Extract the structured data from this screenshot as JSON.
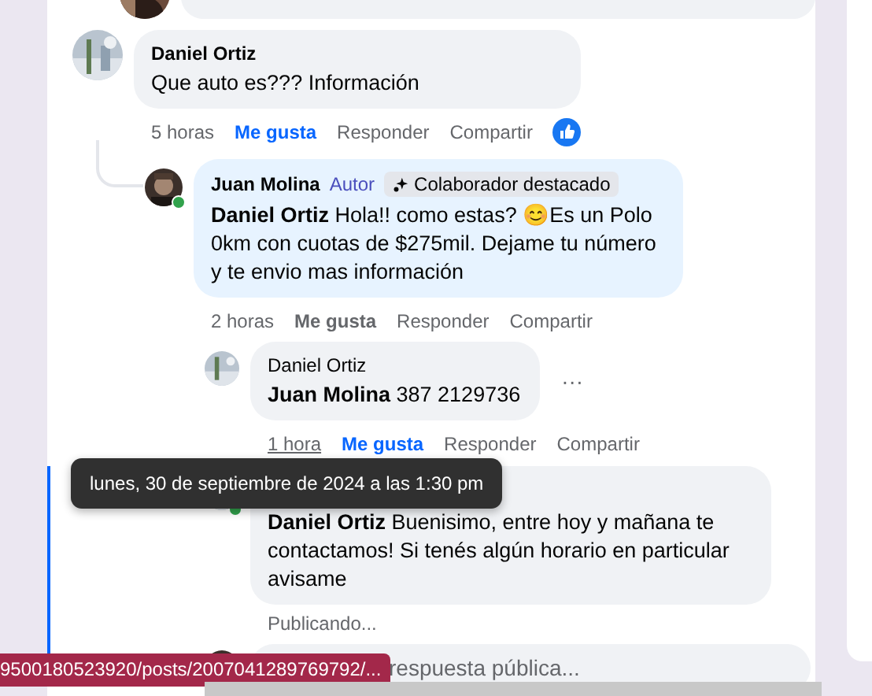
{
  "comments": [
    {
      "author": "Daniel Ortiz",
      "text": "Que auto es??? Información",
      "time": "5 horas",
      "time_hovered": false,
      "like": "Me gusta",
      "liked": true,
      "reply": "Responder",
      "share": "Compartir",
      "reaction": true,
      "replies": [
        {
          "author": "Juan Molina",
          "role": "Autor",
          "badge": "Colaborador destacado",
          "online": true,
          "highlighted": true,
          "text": "**Daniel Ortiz** Hola!! como estas? 😊Es un Polo 0km con cuotas de $275mil. Dejame tu número y te envio mas información",
          "time": "2 horas",
          "time_hovered": false,
          "like": "Me gusta",
          "liked": false,
          "reply": "Responder",
          "share": "Compartir",
          "replies": [
            {
              "author": "Daniel Ortiz",
              "text": "**Juan Molina** 387 2129736",
              "menu": "···",
              "time": "1 hora",
              "time_hovered": true,
              "like": "Me gusta",
              "liked": true,
              "reply": "Responder",
              "share": "Compartir",
              "focused": false
            },
            {
              "online": true,
              "text": "**Daniel Ortiz** Buenisimo, entre hoy y mañana te contactamos! Si tenés algún horario en particular avisame",
              "status": "Publicando...",
              "focused": true
            }
          ],
          "reply_field": {
            "placeholder": "respuesta pública..."
          }
        }
      ]
    }
  ],
  "tooltip": "lunes, 30 de septiembre de 2024 a las 1:30 pm",
  "status_url": "9500180523920/posts/2007041289769792/..."
}
